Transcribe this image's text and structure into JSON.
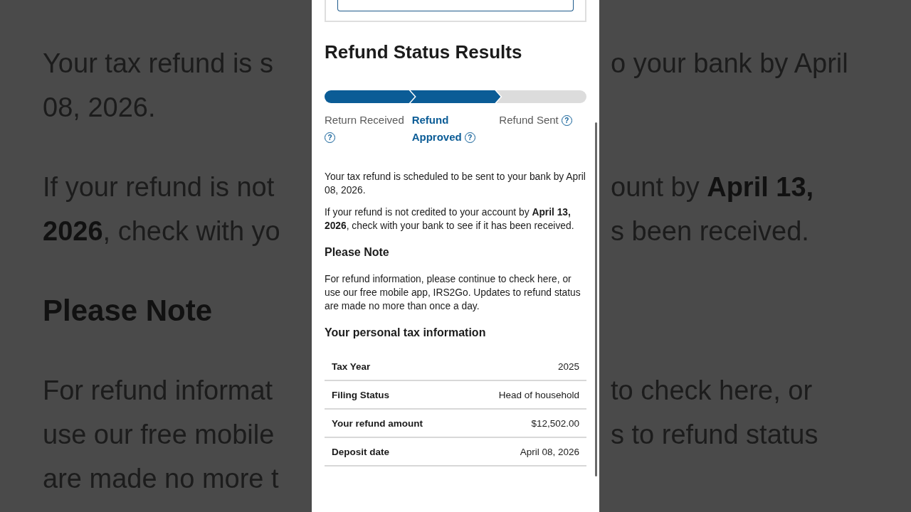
{
  "background": {
    "paragraphs": [
      {
        "kind": "body",
        "lines": [
          {
            "left": "Your tax refund is s",
            "right": "o your bank by April"
          },
          {
            "left": "08, 2026."
          }
        ]
      },
      {
        "kind": "body",
        "lines": [
          {
            "left": "If your refund is not",
            "right": "ount by **April 13,**"
          },
          {
            "left": "**2026**, check with yo",
            "right": "s been received."
          }
        ]
      },
      {
        "kind": "heading",
        "lines": [
          {
            "left": "Please Note"
          }
        ]
      },
      {
        "kind": "body",
        "lines": [
          {
            "left": "For refund informat",
            "right": "to check here, or"
          },
          {
            "left": "use our free mobile",
            "right": "s to refund status"
          },
          {
            "left": "are made no more t"
          }
        ]
      }
    ]
  },
  "page": {
    "title": "Refund Status Results",
    "steps": [
      {
        "label": "Return Received",
        "complete": true,
        "selected": false,
        "help": "?"
      },
      {
        "label": "Refund Approved",
        "complete": true,
        "selected": true,
        "help": "?"
      },
      {
        "label": "Refund Sent",
        "complete": false,
        "selected": false,
        "help": "?"
      }
    ],
    "messages": [
      "Your tax refund is scheduled to be sent to your bank by April 08, 2026.",
      "If your refund is not credited to your account by **April 13, 2026**, check with your bank to see if it has been received."
    ],
    "note": {
      "heading": "Please Note",
      "text": "For refund information, please continue to check here, or use our free mobile app, IRS2Go. Updates to refund status are made no more than once a day."
    },
    "info": {
      "heading": "Your personal tax information",
      "rows": [
        {
          "label": "Tax Year",
          "value": "2025"
        },
        {
          "label": "Filing Status",
          "value": "Head of household"
        },
        {
          "label": "Your refund amount",
          "value": "$12,502.00"
        },
        {
          "label": "Deposit date",
          "value": "April 08, 2026"
        }
      ]
    }
  }
}
